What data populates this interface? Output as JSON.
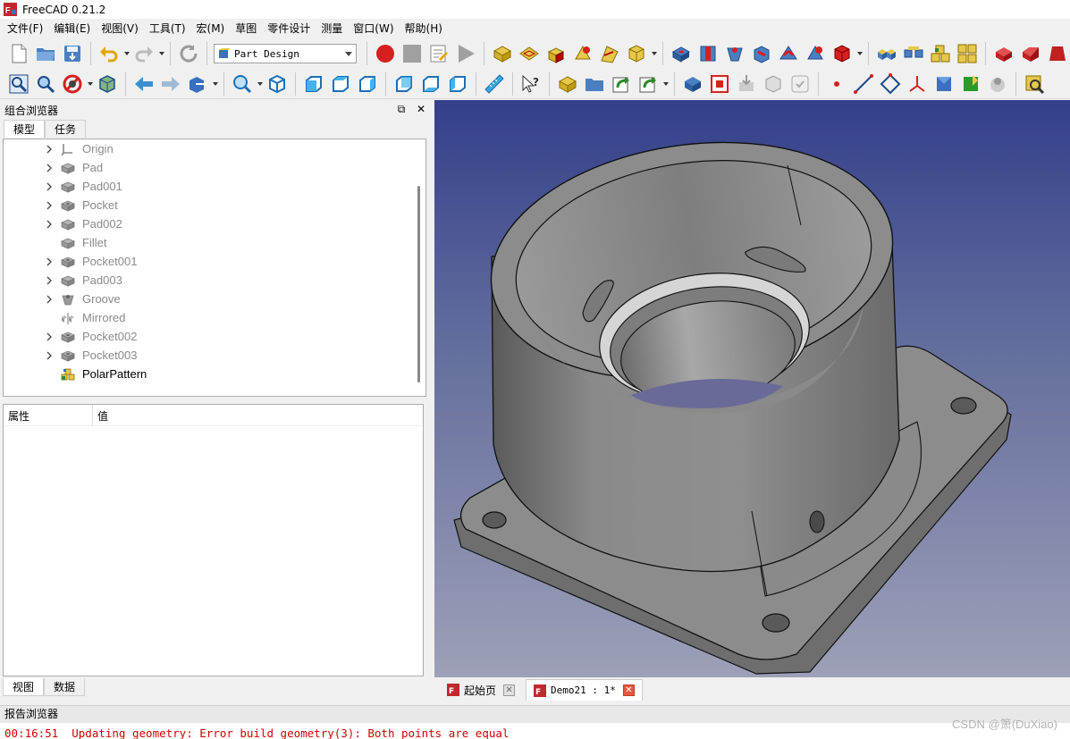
{
  "window": {
    "title": "FreeCAD 0.21.2"
  },
  "menu": [
    "文件(F)",
    "编辑(E)",
    "视图(V)",
    "工具(T)",
    "宏(M)",
    "草图",
    "零件设计",
    "测量",
    "窗口(W)",
    "帮助(H)"
  ],
  "workbench": {
    "selected": "Part Design"
  },
  "combo_view": {
    "title": "组合浏览器",
    "tabs": [
      "模型",
      "任务"
    ],
    "tree": [
      {
        "label": "Origin",
        "icon": "origin-icon",
        "expandable": true,
        "active": false
      },
      {
        "label": "Pad",
        "icon": "pad-icon",
        "expandable": true,
        "active": false
      },
      {
        "label": "Pad001",
        "icon": "pad-icon",
        "expandable": true,
        "active": false
      },
      {
        "label": "Pocket",
        "icon": "pocket-icon",
        "expandable": true,
        "active": false
      },
      {
        "label": "Pad002",
        "icon": "pad-icon",
        "expandable": true,
        "active": false
      },
      {
        "label": "Fillet",
        "icon": "fillet-icon",
        "expandable": false,
        "active": false
      },
      {
        "label": "Pocket001",
        "icon": "pocket-icon",
        "expandable": true,
        "active": false
      },
      {
        "label": "Pad003",
        "icon": "pad-icon",
        "expandable": true,
        "active": false
      },
      {
        "label": "Groove",
        "icon": "groove-icon",
        "expandable": true,
        "active": false
      },
      {
        "label": "Mirrored",
        "icon": "mirrored-icon",
        "expandable": false,
        "active": false
      },
      {
        "label": "Pocket002",
        "icon": "pocket-icon",
        "expandable": true,
        "active": false
      },
      {
        "label": "Pocket003",
        "icon": "pocket-icon",
        "expandable": true,
        "active": false
      },
      {
        "label": "PolarPattern",
        "icon": "polar-pattern-icon",
        "expandable": false,
        "active": true
      }
    ],
    "property_headers": {
      "property": "属性",
      "value": "值"
    },
    "bottom_tabs": [
      "视图",
      "数据"
    ]
  },
  "documents": [
    {
      "label": "起始页",
      "active": false
    },
    {
      "label": "Demo21 : 1*",
      "active": true
    }
  ],
  "report": {
    "title": "报告浏览器",
    "lines": [
      "00:16:51  Updating geometry: Error build geometry(3): Both points are equal"
    ]
  },
  "watermark": "CSDN @箫(DuXiao)",
  "colors": {
    "error": "#d40000",
    "viewport_top": "#333f8a",
    "viewport_bottom": "#9ea0b8"
  }
}
